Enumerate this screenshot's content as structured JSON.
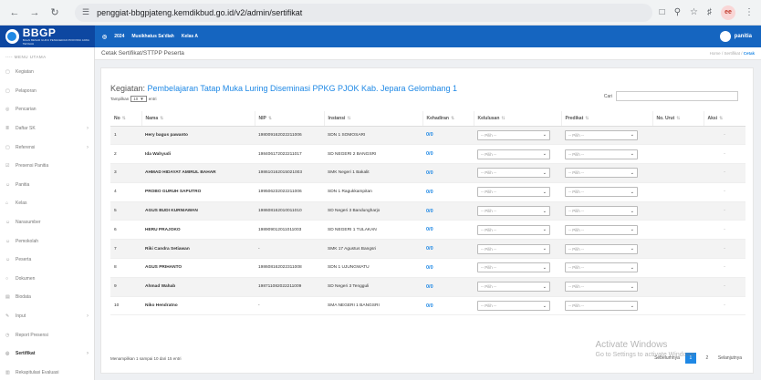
{
  "browser": {
    "url": "penggiat-bbgpjateng.kemdikbud.go.id/v2/admin/sertifikat",
    "profile_initials": "ee"
  },
  "app": {
    "brand": "BBGP",
    "brand_sub": "BALAI BESAR GURU PENGGERAK PROVINSI JAWA TENGAH",
    "year": "2024",
    "org": "Musikhatus Sa'diah",
    "class": "Kelas A",
    "user": "panitia"
  },
  "sidebar": {
    "heading": "MENU UTAMA",
    "items": [
      {
        "label": "Kegiatan",
        "icon": "calendar-icon",
        "chevron": false
      },
      {
        "label": "Pelaporan",
        "icon": "report-icon",
        "chevron": false
      },
      {
        "label": "Pencarian",
        "icon": "search-icon",
        "chevron": false
      },
      {
        "label": "Daftar SK",
        "icon": "list-icon",
        "chevron": true
      },
      {
        "label": "Referensi",
        "icon": "reference-icon",
        "chevron": true
      },
      {
        "label": "Presensi Panitia",
        "icon": "attendance-icon",
        "chevron": false
      },
      {
        "label": "Panitia",
        "icon": "people-icon",
        "chevron": false
      },
      {
        "label": "Kelas",
        "icon": "class-icon",
        "chevron": false
      },
      {
        "label": "Narasumber",
        "icon": "speaker-icon",
        "chevron": false
      },
      {
        "label": "Pemokolah",
        "icon": "group-icon",
        "chevron": false
      },
      {
        "label": "Peserta",
        "icon": "participant-icon",
        "chevron": false
      },
      {
        "label": "Dokumen",
        "icon": "document-icon",
        "chevron": false
      },
      {
        "label": "Biodata",
        "icon": "biodata-icon",
        "chevron": false
      },
      {
        "label": "Input",
        "icon": "input-icon",
        "chevron": true
      },
      {
        "label": "Report Presensi",
        "icon": "report-attendance-icon",
        "chevron": false
      },
      {
        "label": "Sertifikat",
        "icon": "certificate-icon",
        "chevron": true,
        "active": true
      },
      {
        "label": "Rekapitulasi Evaluasi",
        "icon": "recap-icon",
        "chevron": false
      }
    ]
  },
  "page": {
    "title": "Cetak Sertifikat/STTPP Peserta",
    "breadcrumb": [
      "Home",
      "Sertifikat",
      "Cetak"
    ],
    "kegiatan_prefix": "Kegiatan:",
    "kegiatan_name": "Pembelajaran Tatap Muka Luring Diseminasi PPKG PJOK Kab. Jepara Gelombang 1",
    "tampilkan": "Tampilkan",
    "show_count": "10",
    "entri": "entri",
    "cari": "Cari"
  },
  "table": {
    "headers": [
      "No",
      "Nama",
      "NIP",
      "Instansi",
      "Kehadiran",
      "Kelulusan",
      "Predikat",
      "No. Urut",
      "Aksi"
    ],
    "select_placeholder": "-- Pilih --",
    "rows": [
      {
        "no": "1",
        "nama": "Hery bagus pawanto",
        "nip": "198009162022211006",
        "instansi": "SDN 1 SOMOSARI",
        "kehadiran": "0/0",
        "aksi": "-"
      },
      {
        "no": "2",
        "nama": "Ida Wahyudi",
        "nip": "198406172022211017",
        "instansi": "SD NEGERI 2 BANGSRI",
        "kehadiran": "0/0",
        "aksi": "-"
      },
      {
        "no": "3",
        "nama": "AHMAD HIDAYAT AMIRUL BAHAR",
        "nip": "198610162015021003",
        "instansi": "SMK Negeri 1 Bakalit",
        "kehadiran": "0/0",
        "aksi": "-"
      },
      {
        "no": "4",
        "nama": "PROBO GURUH SAPUTRO",
        "nip": "199506232022211006",
        "instansi": "SDN 1 Ragukkampitan",
        "kehadiran": "0/0",
        "aksi": "-"
      },
      {
        "no": "5",
        "nama": "AGUS BUDI KURNIAWAN",
        "nip": "198608162010011010",
        "instansi": "SD Negeri 3 Bandungharjo",
        "kehadiran": "0/0",
        "aksi": "-"
      },
      {
        "no": "6",
        "nama": "HERU PRAJOKO",
        "nip": "198909012011011003",
        "instansi": "SD NEGERI 1 TULAKAN",
        "kehadiran": "0/0",
        "aksi": "-"
      },
      {
        "no": "7",
        "nama": "Riki Candra Setiawan",
        "nip": "-",
        "instansi": "SMK 17 Agustus Bangsri",
        "kehadiran": "0/0",
        "aksi": "-"
      },
      {
        "no": "8",
        "nama": "AGUS PRIHANTO",
        "nip": "198608162022311008",
        "instansi": "SDN 1 UJUNGWATU",
        "kehadiran": "0/0",
        "aksi": "-"
      },
      {
        "no": "9",
        "nama": "Ahmad Wahab",
        "nip": "198711082022211009",
        "instansi": "SD Negeri 3 Tengguli",
        "kehadiran": "0/0",
        "aksi": "-"
      },
      {
        "no": "10",
        "nama": "Niko Hendratno",
        "nip": "-",
        "instansi": "SMA NEGERI 1 BANGSRI",
        "kehadiran": "0/0",
        "aksi": "-"
      }
    ]
  },
  "footer": {
    "info": "Menampilkan 1 sampai 10 dari 15 entri",
    "prev": "Sebelumnya",
    "pages": [
      "1",
      "2"
    ],
    "active_page": "1",
    "next": "Selanjutnya"
  },
  "watermark": {
    "line1": "Activate Windows",
    "line2": "Go to Settings to activate Windows."
  }
}
